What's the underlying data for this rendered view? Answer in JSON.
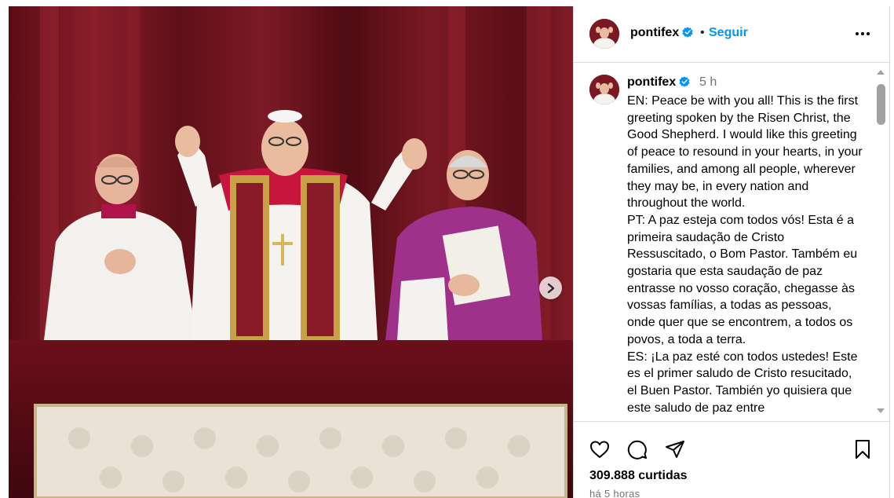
{
  "post": {
    "username": "pontifex",
    "follow_label": "Seguir",
    "separator": "•",
    "time_short": "5 h",
    "caption": "EN: Peace be with you all! This is the first greeting spoken by the Risen Christ, the Good Shepherd. I would like this greeting of peace to resound in your hearts, in your families, and among all people, wherever they may be, in every nation and throughout the world.\nPT: A paz esteja com todos vós! Esta é a primeira saudação de Cristo Ressuscitado, o Bom Pastor. Também eu gostaria que esta saudação de paz entrasse no vosso coração, chegasse às vossas famílias, a todas as pessoas, onde quer que se encontrem, a todos os povos, a toda a terra.\nES: ¡La paz esté con todos ustedes! Este es el primer saludo de Cristo resucitado, el Buen Pastor. También yo quisiera que este saludo de paz entre",
    "likes": "309.888 curtidas",
    "time_ago": "há 5 horas"
  },
  "icons": {
    "verified": "verified-badge-icon",
    "more": "more-options-icon",
    "like": "heart-icon",
    "comment": "comment-icon",
    "share": "share-icon",
    "save": "bookmark-icon",
    "next": "chevron-right-icon"
  },
  "colors": {
    "link_blue": "#0095f6",
    "verified_blue": "#0095f6",
    "muted": "#737373",
    "border": "#dbdbdb"
  }
}
